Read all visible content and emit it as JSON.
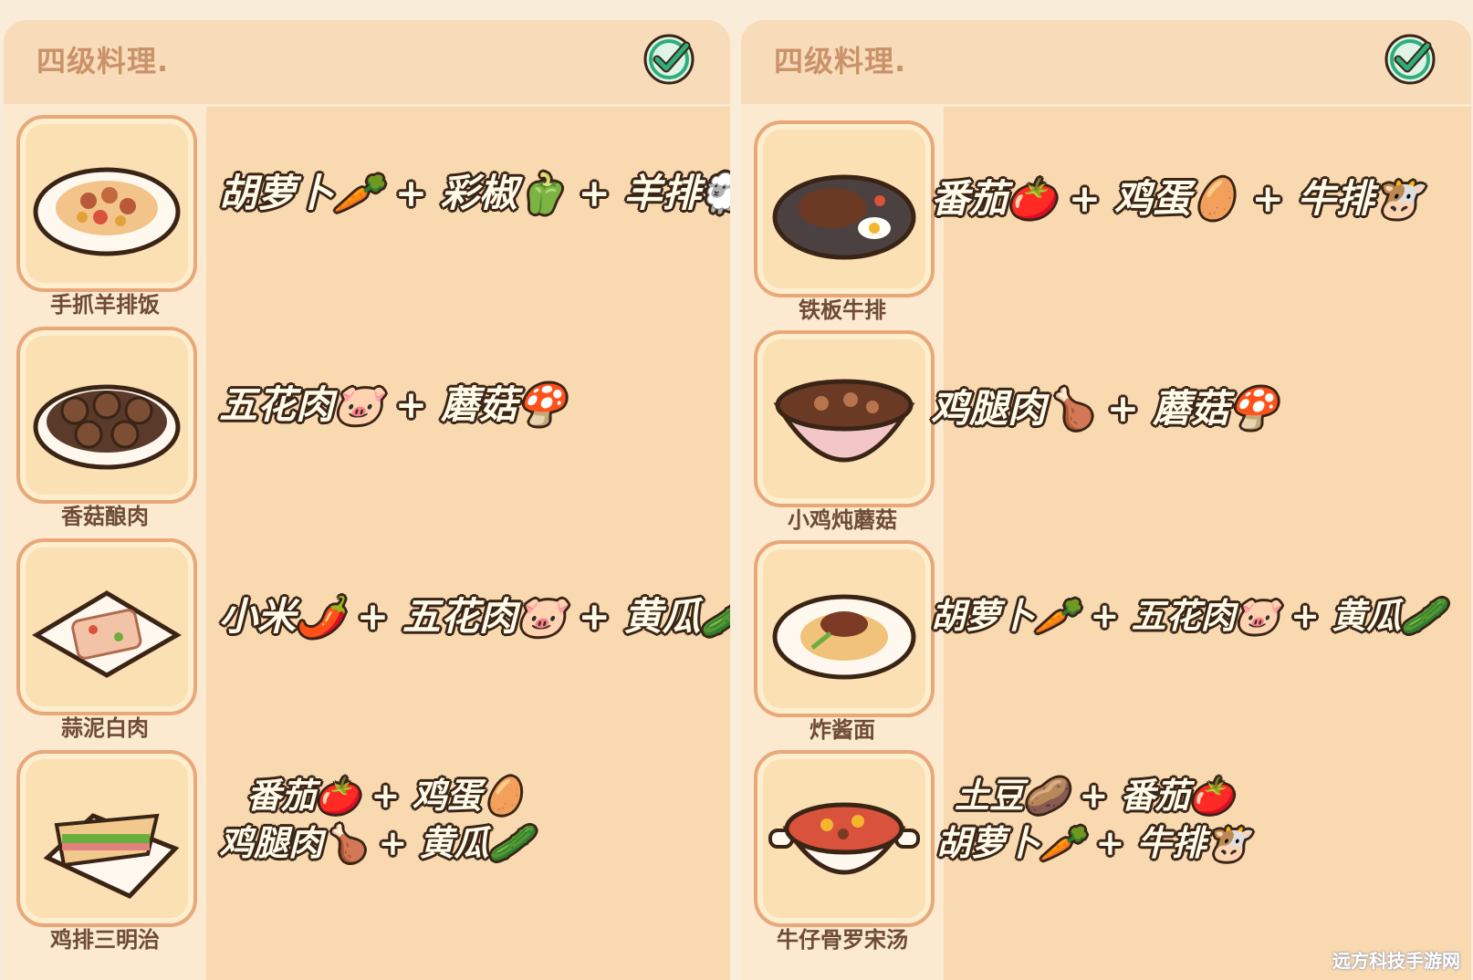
{
  "panels": [
    {
      "title": "四级料理.",
      "recipes": [
        {
          "dish": "手抓羊排饭",
          "formula": [
            "胡萝卜🥕 + 彩椒🫑 + 羊排🐑"
          ]
        },
        {
          "dish": "香菇酿肉",
          "formula": [
            "五花肉🐷 + 蘑菇🍄"
          ]
        },
        {
          "dish": "蒜泥白肉",
          "formula": [
            "小米🌶️ + 五花肉🐷 + 黄瓜🥒"
          ]
        },
        {
          "dish": "鸡排三明治",
          "formula": [
            "番茄🍅 + 鸡蛋🥚",
            "鸡腿肉🍗 + 黄瓜🥒"
          ]
        }
      ]
    },
    {
      "title": "四级料理.",
      "recipes": [
        {
          "dish": "铁板牛排",
          "formula": [
            "番茄🍅 + 鸡蛋🥚 + 牛排🐮"
          ]
        },
        {
          "dish": "小鸡炖蘑菇",
          "formula": [
            "鸡腿肉🍗 + 蘑菇🍄"
          ]
        },
        {
          "dish": "炸酱面",
          "formula": [
            "胡萝卜🥕 + 五花肉🐷 + 黄瓜🥒"
          ]
        },
        {
          "dish": "牛仔骨罗宋汤",
          "formula": [
            "土豆🥔 + 番茄🍅",
            "胡萝卜🥕 + 牛排🐮"
          ]
        }
      ]
    }
  ],
  "icons": {
    "check": "check-circle-icon",
    "dishes": [
      "lamb-rice-plate-icon",
      "stuffed-mushroom-plate-icon",
      "garlic-pork-plate-icon",
      "sandwich-plate-icon",
      "iron-steak-plate-icon",
      "chicken-mushroom-bowl-icon",
      "noodle-plate-icon",
      "borscht-pot-icon"
    ]
  },
  "colors": {
    "panel": "#f9d9b0",
    "title": "#c9926a",
    "check": "#2fae7b",
    "outline": "#3a2416"
  },
  "watermark": "远方科技手游网"
}
